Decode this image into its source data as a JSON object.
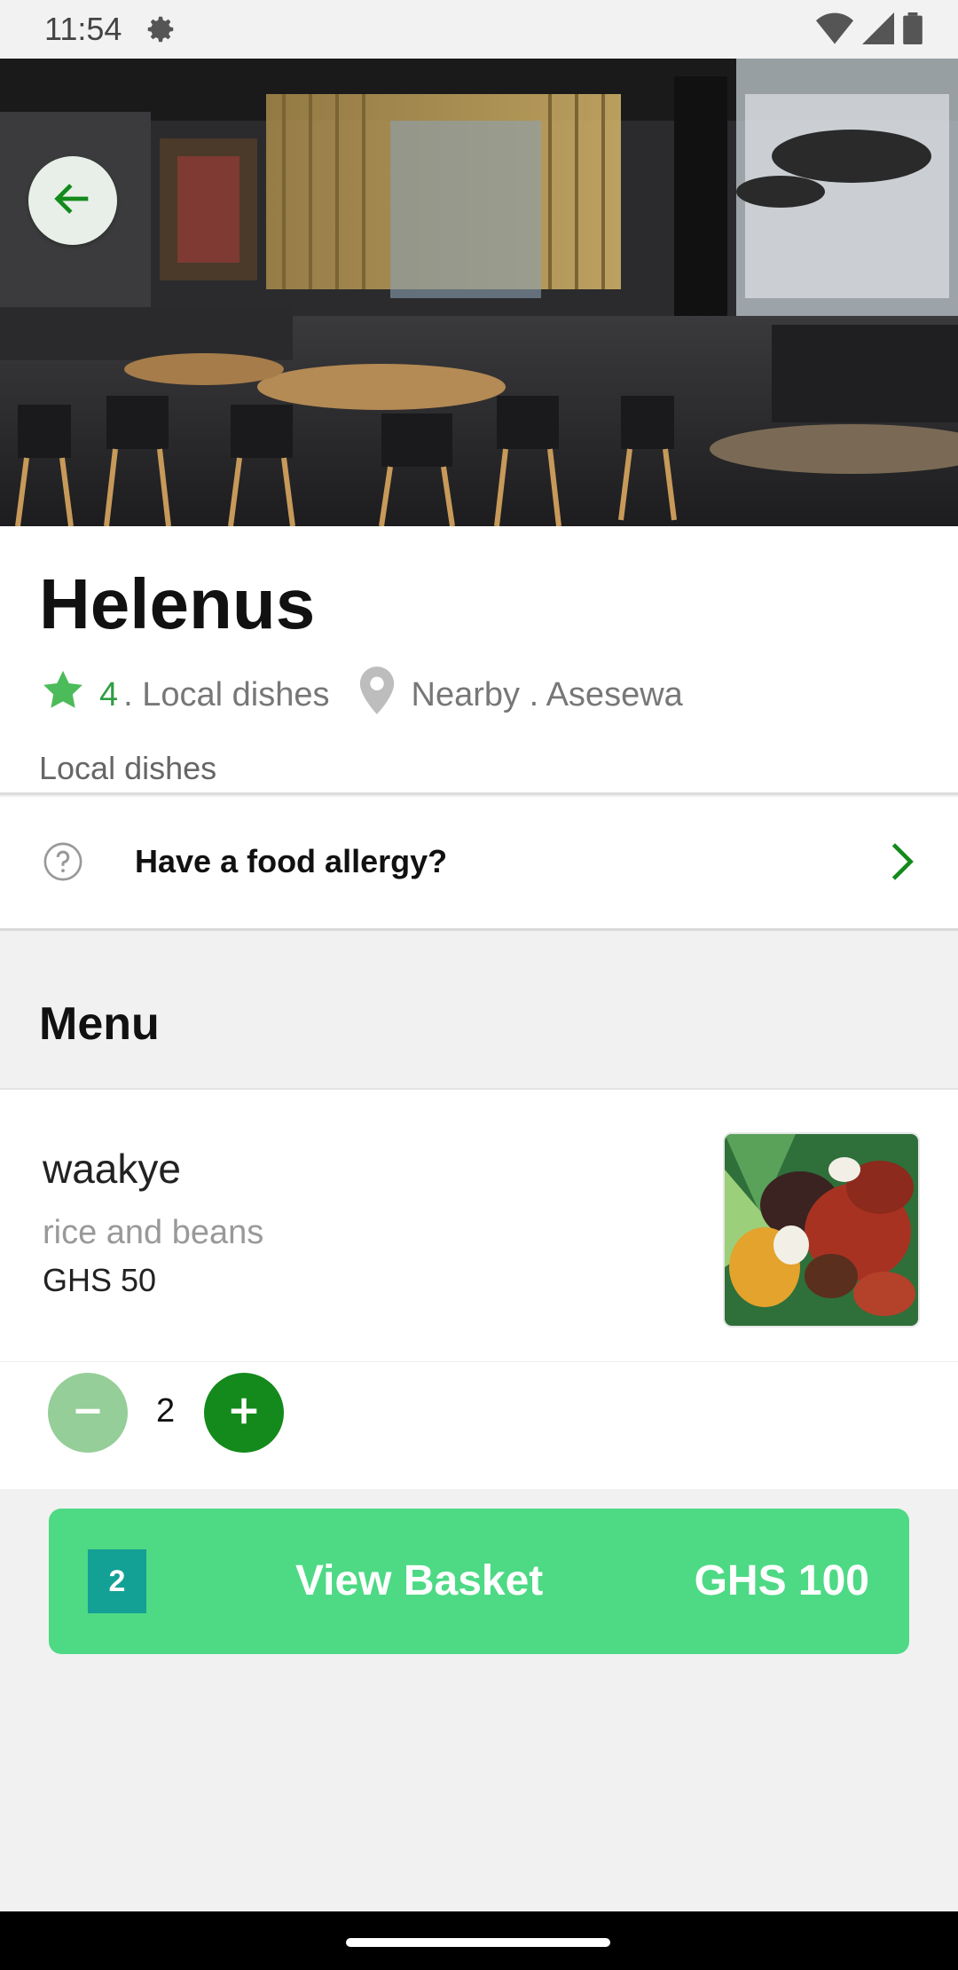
{
  "status_bar": {
    "time": "11:54",
    "icons": [
      "gear-icon",
      "wifi-icon",
      "signal-icon",
      "battery-icon"
    ]
  },
  "restaurant": {
    "name": "Helenus",
    "rating": "4",
    "category_suffix": ". Local dishes",
    "location": "Nearby . Asesewa",
    "subcategory": "Local dishes"
  },
  "allergy": {
    "label": "Have a food allergy?"
  },
  "menu": {
    "title": "Menu",
    "items": [
      {
        "name": "waakye",
        "description": "rice and beans",
        "price": "GHS 50",
        "quantity": "2"
      }
    ]
  },
  "basket": {
    "count": "2",
    "label": "View Basket",
    "total": "GHS 100"
  },
  "colors": {
    "accent_green": "#138a1b",
    "light_green": "#95ce98",
    "basket_green": "#4ed985",
    "badge_teal": "#13a095",
    "star_green": "#2f9e44"
  }
}
